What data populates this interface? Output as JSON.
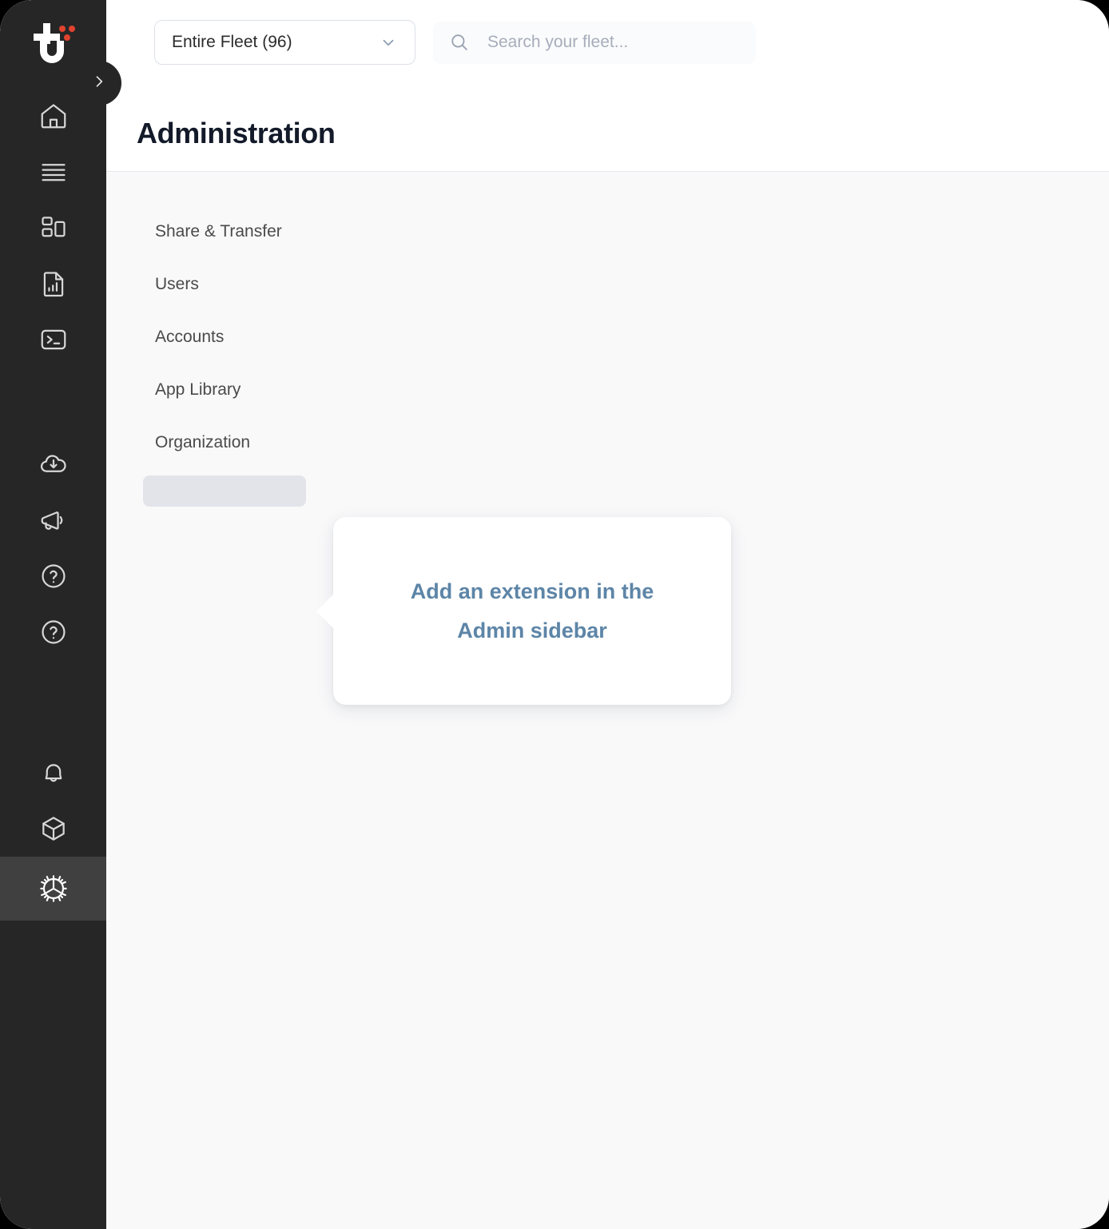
{
  "theme": {
    "rail_bg": "#262626",
    "rail_active_bg": "#404040",
    "accent_red": "#e0432f",
    "content_bg": "#f9f9fa",
    "header_bg": "#ffffff",
    "border": "#e4e8ed",
    "title_color": "#131a29",
    "callout_text_color": "#5d85a7",
    "skeleton_color": "#e2e4e9"
  },
  "rail": {
    "logo_name": "product-logo",
    "toggle_label": "›",
    "items_top": [
      {
        "name": "home",
        "label": "Home"
      },
      {
        "name": "list",
        "label": "List"
      },
      {
        "name": "dashboard",
        "label": "Dashboard"
      },
      {
        "name": "reports",
        "label": "Reports"
      },
      {
        "name": "terminal",
        "label": "Terminal"
      }
    ],
    "items_mid": [
      {
        "name": "cloud-download",
        "label": "Downloads"
      },
      {
        "name": "megaphone",
        "label": "Announcements"
      },
      {
        "name": "help",
        "label": "Help"
      },
      {
        "name": "support",
        "label": "Support"
      }
    ],
    "items_bottom": [
      {
        "name": "bell",
        "label": "Notifications",
        "active": false
      },
      {
        "name": "package",
        "label": "Packages",
        "active": false
      },
      {
        "name": "gear",
        "label": "Settings",
        "active": true
      }
    ]
  },
  "topbar": {
    "fleet_filter": {
      "value": "Entire Fleet (96)",
      "chevron": "chevron-down-icon"
    },
    "search": {
      "placeholder": "Search your fleet...",
      "value": "",
      "icon": "search-icon"
    }
  },
  "page": {
    "title": "Administration"
  },
  "admin_nav": {
    "items": [
      {
        "label": "Share & Transfer"
      },
      {
        "label": "Users"
      },
      {
        "label": "Accounts"
      },
      {
        "label": "App Library"
      },
      {
        "label": "Organization"
      }
    ],
    "placeholder_slot": ""
  },
  "callout": {
    "text": "Add an extension in the Admin sidebar"
  }
}
